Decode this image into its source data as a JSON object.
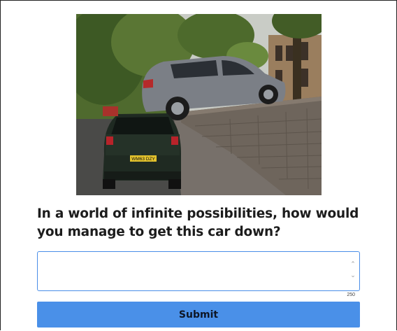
{
  "question": {
    "text": "In a world of infinite possibilities, how would you manage to get this car down?"
  },
  "answer": {
    "value": "",
    "placeholder": "",
    "char_limit": "250"
  },
  "submit": {
    "label": "Submit"
  },
  "photo": {
    "plate_text": "WM63 DZY"
  }
}
